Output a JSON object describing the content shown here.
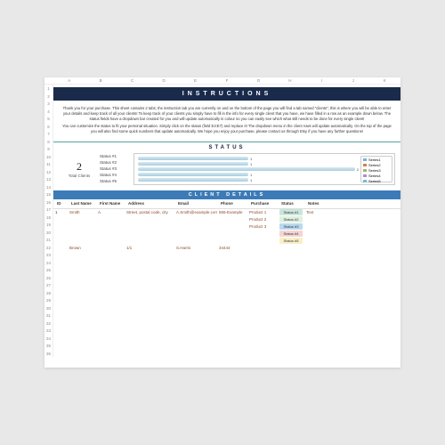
{
  "columns": [
    "A",
    "B",
    "C",
    "D",
    "E",
    "F",
    "G",
    "H",
    "I",
    "J",
    "K"
  ],
  "rows": [
    "1",
    "2",
    "3",
    "4",
    "5",
    "6",
    "7",
    "8",
    "9",
    "10",
    "11",
    "12",
    "13",
    "14",
    "15",
    "16",
    "17",
    "18",
    "19",
    "20",
    "21",
    "22",
    "23",
    "24",
    "25",
    "26",
    "27",
    "28",
    "29",
    "30",
    "31",
    "32",
    "33",
    "34",
    "35",
    "36"
  ],
  "banner": "INSTRUCTIONS",
  "intro": {
    "p1": "Thank you for your purchase. This sheet contains 2 tabs; the instruction tab you are currently on and on the bottom of the page you will find a tab named \"clients\", this is where you will be able to enter your details and keep track of all your clients! To keep track of your clients you simply have to fill in the info for every single client that you have, we have filled in a row as an example down below. The status fields have a dropdown bar created for you and will update automatically in colour so you can easily see which what still needs to be done for every single client!",
    "p2": "You can customize the status to fit your personal situation. Simply click on the status (field E3:E7) and replace it! The dropdown menu in the client rows will update automatically. On the top of the page you will also find some quick numbers that update automatically. We hope you enjoy your purchase, please contact us through Etsy if you have any further questions!"
  },
  "status_section": {
    "title": "STATUS",
    "total_value": "2",
    "total_label": "Total Clients",
    "labels": [
      "Status #1",
      "Status #2",
      "Status #3",
      "Status #4",
      "Status #5"
    ]
  },
  "chart_data": {
    "type": "bar",
    "categories": [
      "Status #1",
      "Status #2",
      "Status #3",
      "Status #4",
      "Status #5"
    ],
    "values": [
      1,
      1,
      2,
      1,
      1
    ],
    "title": "",
    "xlabel": "",
    "ylabel": "",
    "ylim": [
      0,
      2
    ],
    "series": [
      {
        "name": "Series1",
        "color": "#6fb8d8"
      },
      {
        "name": "Series2",
        "color": "#d97a5a"
      },
      {
        "name": "Series3",
        "color": "#9fb86a"
      },
      {
        "name": "Series4",
        "color": "#b38bd1"
      },
      {
        "name": "Series5",
        "color": "#6fc4c7"
      }
    ]
  },
  "details": {
    "title": "CLIENT DETAILS",
    "headers": [
      "ID",
      "Last Name",
      "First Name",
      "Address",
      "Email",
      "Phone",
      "Purchase",
      "Status",
      "Notes"
    ],
    "rows": [
      {
        "id": "1",
        "last": "Smith",
        "first": "A.",
        "addr": "Street, postal code, city",
        "email": "A.Smith@example.com",
        "phone": "555-Example",
        "purchases": [
          "Product 1",
          "Product 2",
          "Product 3"
        ],
        "statuses": [
          "Status #1",
          "Status #2",
          "Status #3",
          "Status #4",
          "Status #5"
        ],
        "notes": "Text"
      },
      {
        "id": "",
        "last": "Brown",
        "first": "",
        "addr": "1/1",
        "email": "S.Harris",
        "phone": "34444",
        "purchases": [],
        "statuses": [],
        "notes": ""
      }
    ]
  }
}
